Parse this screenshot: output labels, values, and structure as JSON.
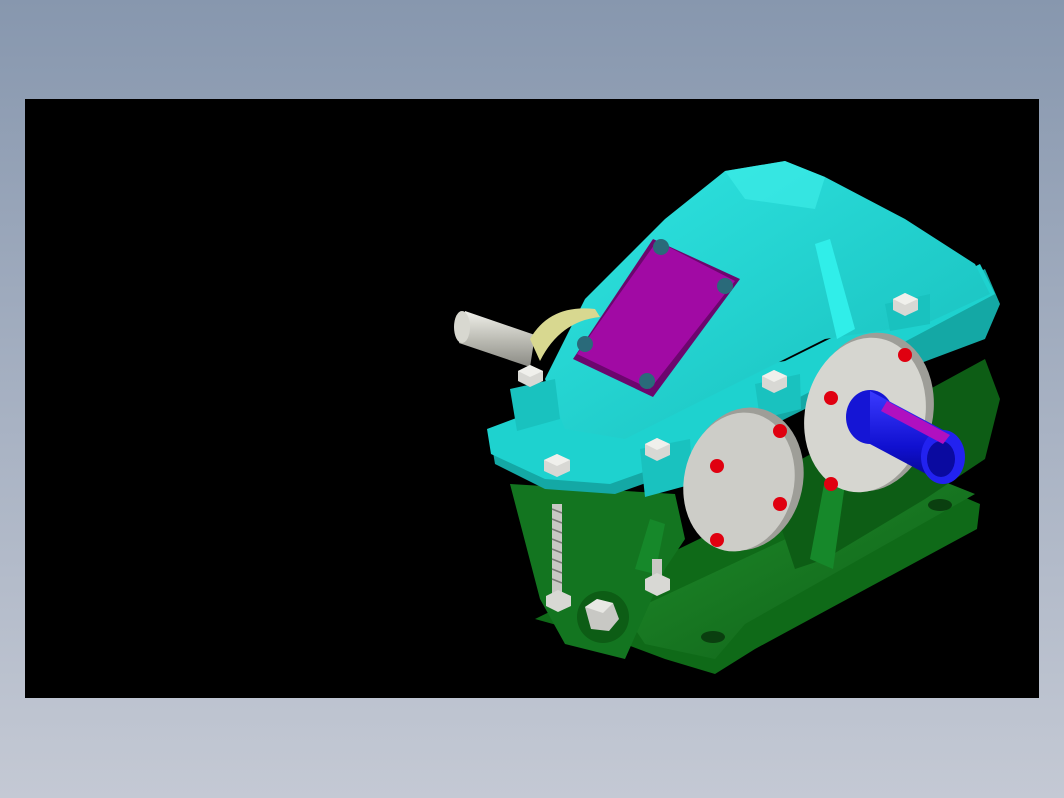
{
  "app": {
    "background_top_color": "#8797ae",
    "background_bottom_color": "#c4c9d4"
  },
  "viewport": {
    "background_color": "#000000",
    "model": {
      "subject": "gear-reducer-assembly",
      "colors": {
        "upper_housing": "#1ed2cf",
        "lower_housing": "#14781f",
        "inspection_cover": "#a10aa4",
        "end_caps": "#cdcdc8",
        "cap_bolts": "#e00010",
        "output_shaft": "#1010e0",
        "key": "#b010c0",
        "input_shaft": "#c8c8c0",
        "seal": "#d8d890",
        "hex_bolts": "#c0c0c0"
      }
    }
  }
}
